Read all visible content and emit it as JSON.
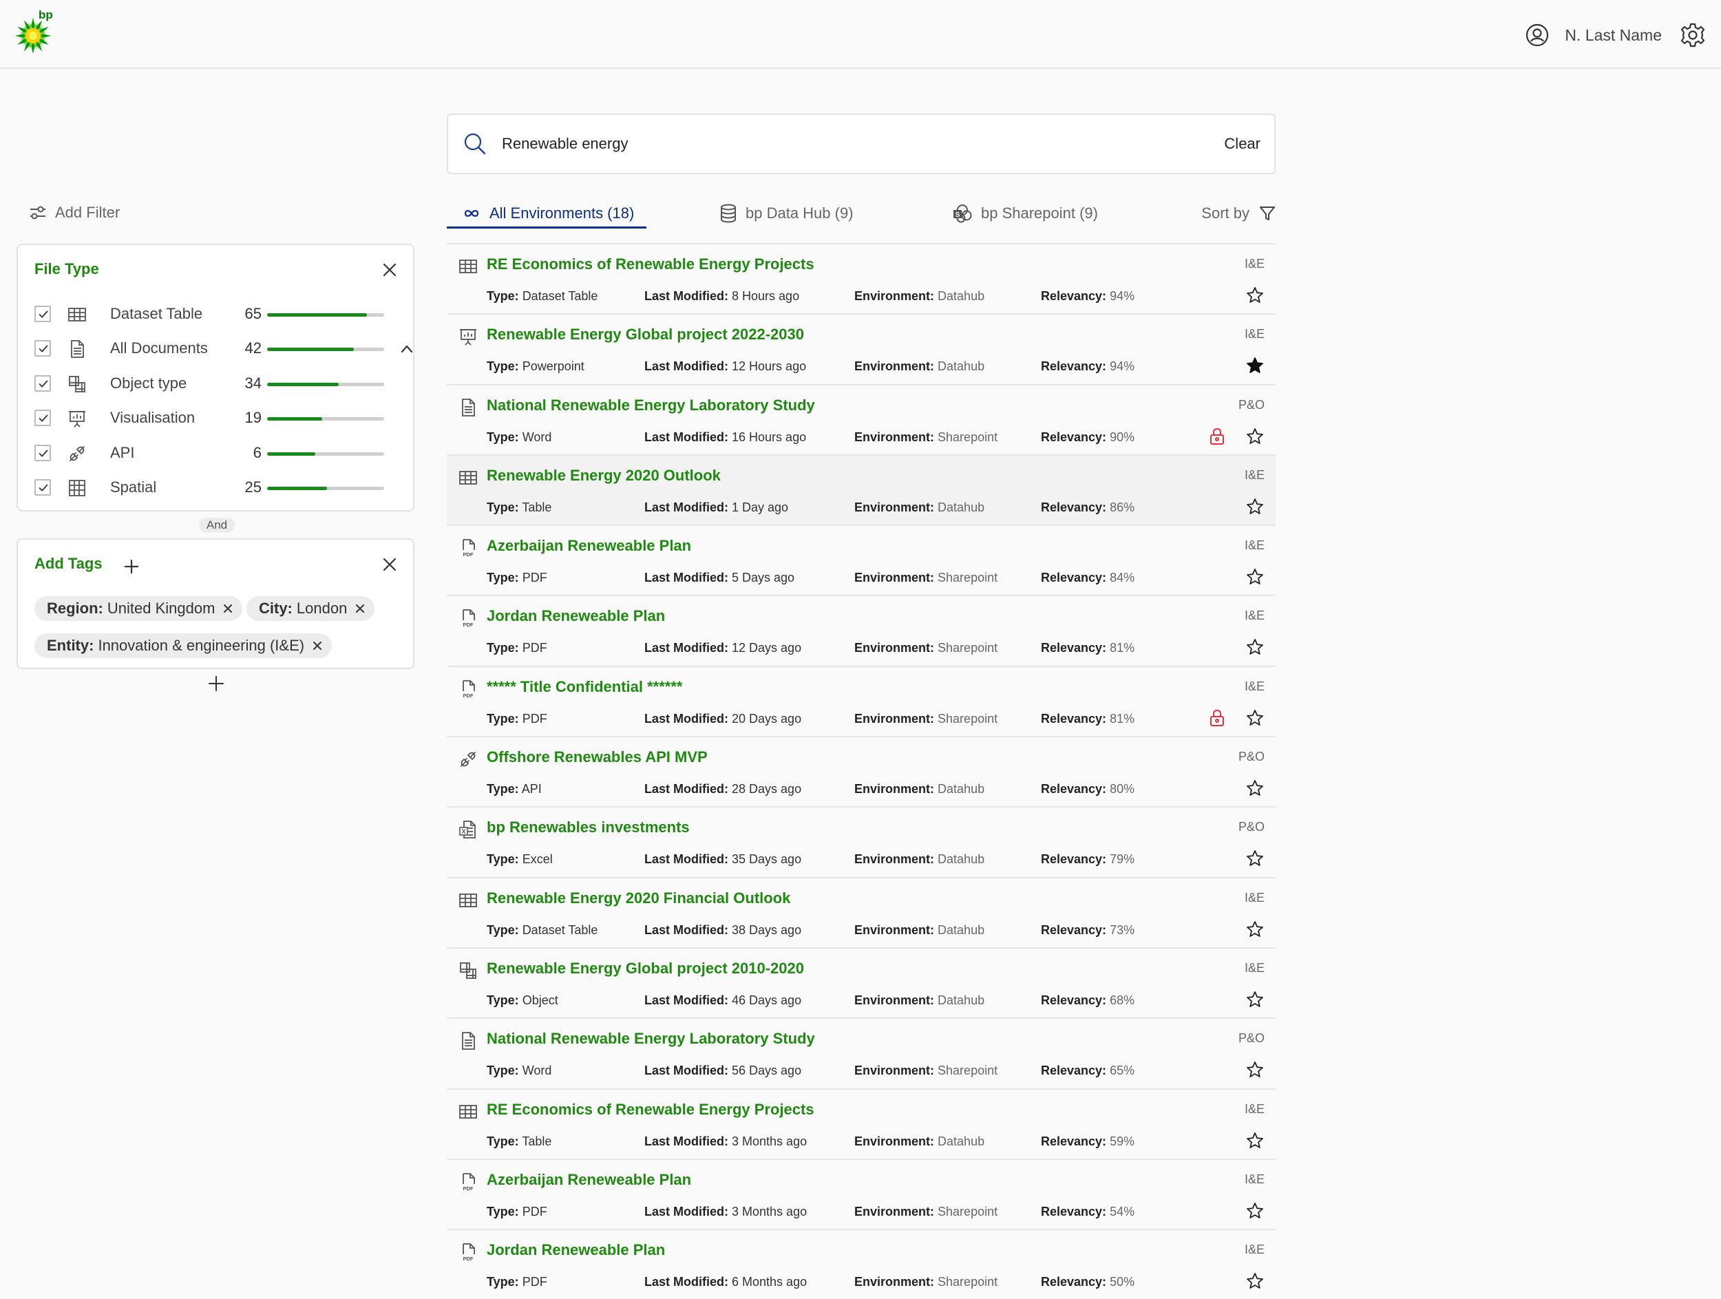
{
  "brand": {
    "logo_text": "bp",
    "green": "#007f00",
    "yellow": "#ffd400"
  },
  "header": {
    "user_name": "N. Last Name",
    "user_icon": "user-circle-icon",
    "settings_icon": "gear-icon"
  },
  "search": {
    "query": "Renewable energy",
    "clear_label": "Clear"
  },
  "tabs": [
    {
      "label": "All Environments (18)",
      "icon": "infinity-icon",
      "active": true
    },
    {
      "label": "bp Data Hub (9)",
      "icon": "database-icon",
      "active": false
    },
    {
      "label": "bp Sharepoint (9)",
      "icon": "sharepoint-icon",
      "active": false
    }
  ],
  "sort": {
    "label": "Sort by",
    "icon": "filter-funnel-icon"
  },
  "filters": {
    "add_label": "Add Filter",
    "file_type": {
      "title": "File Type",
      "items": [
        {
          "label": "Dataset Table",
          "count": "65",
          "fraction": 0.85,
          "icon": "table-icon"
        },
        {
          "label": "All Documents",
          "count": "42",
          "fraction": 0.74,
          "icon": "document-icon"
        },
        {
          "label": "Object type",
          "count": "34",
          "fraction": 0.61,
          "icon": "object-icon"
        },
        {
          "label": "Visualisation",
          "count": "19",
          "fraction": 0.47,
          "icon": "presentation-icon"
        },
        {
          "label": "API",
          "count": "6",
          "fraction": 0.41,
          "icon": "api-icon"
        },
        {
          "label": "Spatial",
          "count": "25",
          "fraction": 0.51,
          "icon": "grid-icon"
        }
      ]
    },
    "and_label": "And",
    "tags": {
      "title": "Add Tags",
      "chips": [
        {
          "key": "Region:",
          "value": "United Kingdom"
        },
        {
          "key": "City:",
          "value": "London"
        },
        {
          "key": "Entity:",
          "value": "Innovation & engineering (I&E)"
        }
      ]
    }
  },
  "labels": {
    "type": "Type:",
    "modified": "Last Modified:",
    "env": "Environment:",
    "rel": "Relevancy:"
  },
  "results": [
    {
      "title": "RE Economics of Renewable Energy Projects",
      "org": "I&E",
      "type": "Dataset Table",
      "modified": "8 Hours ago",
      "env": "Datahub",
      "rel": "94%",
      "icon": "table-icon",
      "locked": false,
      "starred": false
    },
    {
      "title": "Renewable Energy Global project 2022-2030",
      "org": "I&E",
      "type": "Powerpoint",
      "modified": "12 Hours ago",
      "env": "Datahub",
      "rel": "94%",
      "icon": "presentation-icon",
      "locked": false,
      "starred": true
    },
    {
      "title": "National Renewable Energy Laboratory Study",
      "org": "P&O",
      "type": "Word",
      "modified": "16 Hours ago",
      "env": "Sharepoint",
      "rel": "90%",
      "icon": "document-icon",
      "locked": true,
      "starred": false
    },
    {
      "title": "Renewable Energy 2020 Outlook",
      "org": "I&E",
      "type": "Table",
      "modified": "1 Day ago",
      "env": "Datahub",
      "rel": "86%",
      "icon": "table-icon",
      "locked": false,
      "starred": false
    },
    {
      "title": "Azerbaijan Reneweable Plan",
      "org": "I&E",
      "type": "PDF",
      "modified": "5 Days ago",
      "env": "Sharepoint",
      "rel": "84%",
      "icon": "pdf-icon",
      "locked": false,
      "starred": false
    },
    {
      "title": "Jordan Reneweable Plan",
      "org": "I&E",
      "type": "PDF",
      "modified": "12 Days ago",
      "env": "Sharepoint",
      "rel": "81%",
      "icon": "pdf-icon",
      "locked": false,
      "starred": false
    },
    {
      "title": "***** Title Confidential ******",
      "org": "I&E",
      "type": "PDF",
      "modified": "20 Days ago",
      "env": "Sharepoint",
      "rel": "81%",
      "icon": "pdf-icon",
      "locked": true,
      "starred": false
    },
    {
      "title": "Offshore Renewables API MVP",
      "org": "P&O",
      "type": "API",
      "modified": "28 Days ago",
      "env": "Datahub",
      "rel": "80%",
      "icon": "api-icon",
      "locked": false,
      "starred": false
    },
    {
      "title": "bp Renewables investments",
      "org": "P&O",
      "type": "Excel",
      "modified": "35 Days ago",
      "env": "Datahub",
      "rel": "79%",
      "icon": "excel-icon",
      "locked": false,
      "starred": false
    },
    {
      "title": "Renewable Energy 2020 Financial Outlook",
      "org": "I&E",
      "type": "Dataset Table",
      "modified": "38 Days ago",
      "env": "Datahub",
      "rel": "73%",
      "icon": "table-icon",
      "locked": false,
      "starred": false
    },
    {
      "title": "Renewable Energy Global project 2010-2020",
      "org": "I&E",
      "type": "Object",
      "modified": "46 Days ago",
      "env": "Datahub",
      "rel": "68%",
      "icon": "object-icon",
      "locked": false,
      "starred": false
    },
    {
      "title": "National Renewable Energy Laboratory Study",
      "org": "P&O",
      "type": "Word",
      "modified": "56 Days ago",
      "env": "Sharepoint",
      "rel": "65%",
      "icon": "document-icon",
      "locked": false,
      "starred": false
    },
    {
      "title": "RE Economics of Renewable Energy Projects",
      "org": "I&E",
      "type": "Table",
      "modified": "3 Months ago",
      "env": "Datahub",
      "rel": "59%",
      "icon": "table-icon",
      "locked": false,
      "starred": false
    },
    {
      "title": "Azerbaijan Reneweable Plan",
      "org": "I&E",
      "type": "PDF",
      "modified": "3 Months ago",
      "env": "Sharepoint",
      "rel": "54%",
      "icon": "pdf-icon",
      "locked": false,
      "starred": false
    },
    {
      "title": "Jordan Reneweable Plan",
      "org": "I&E",
      "type": "PDF",
      "modified": "6 Months ago",
      "env": "Sharepoint",
      "rel": "50%",
      "icon": "pdf-icon",
      "locked": false,
      "starred": false
    }
  ]
}
